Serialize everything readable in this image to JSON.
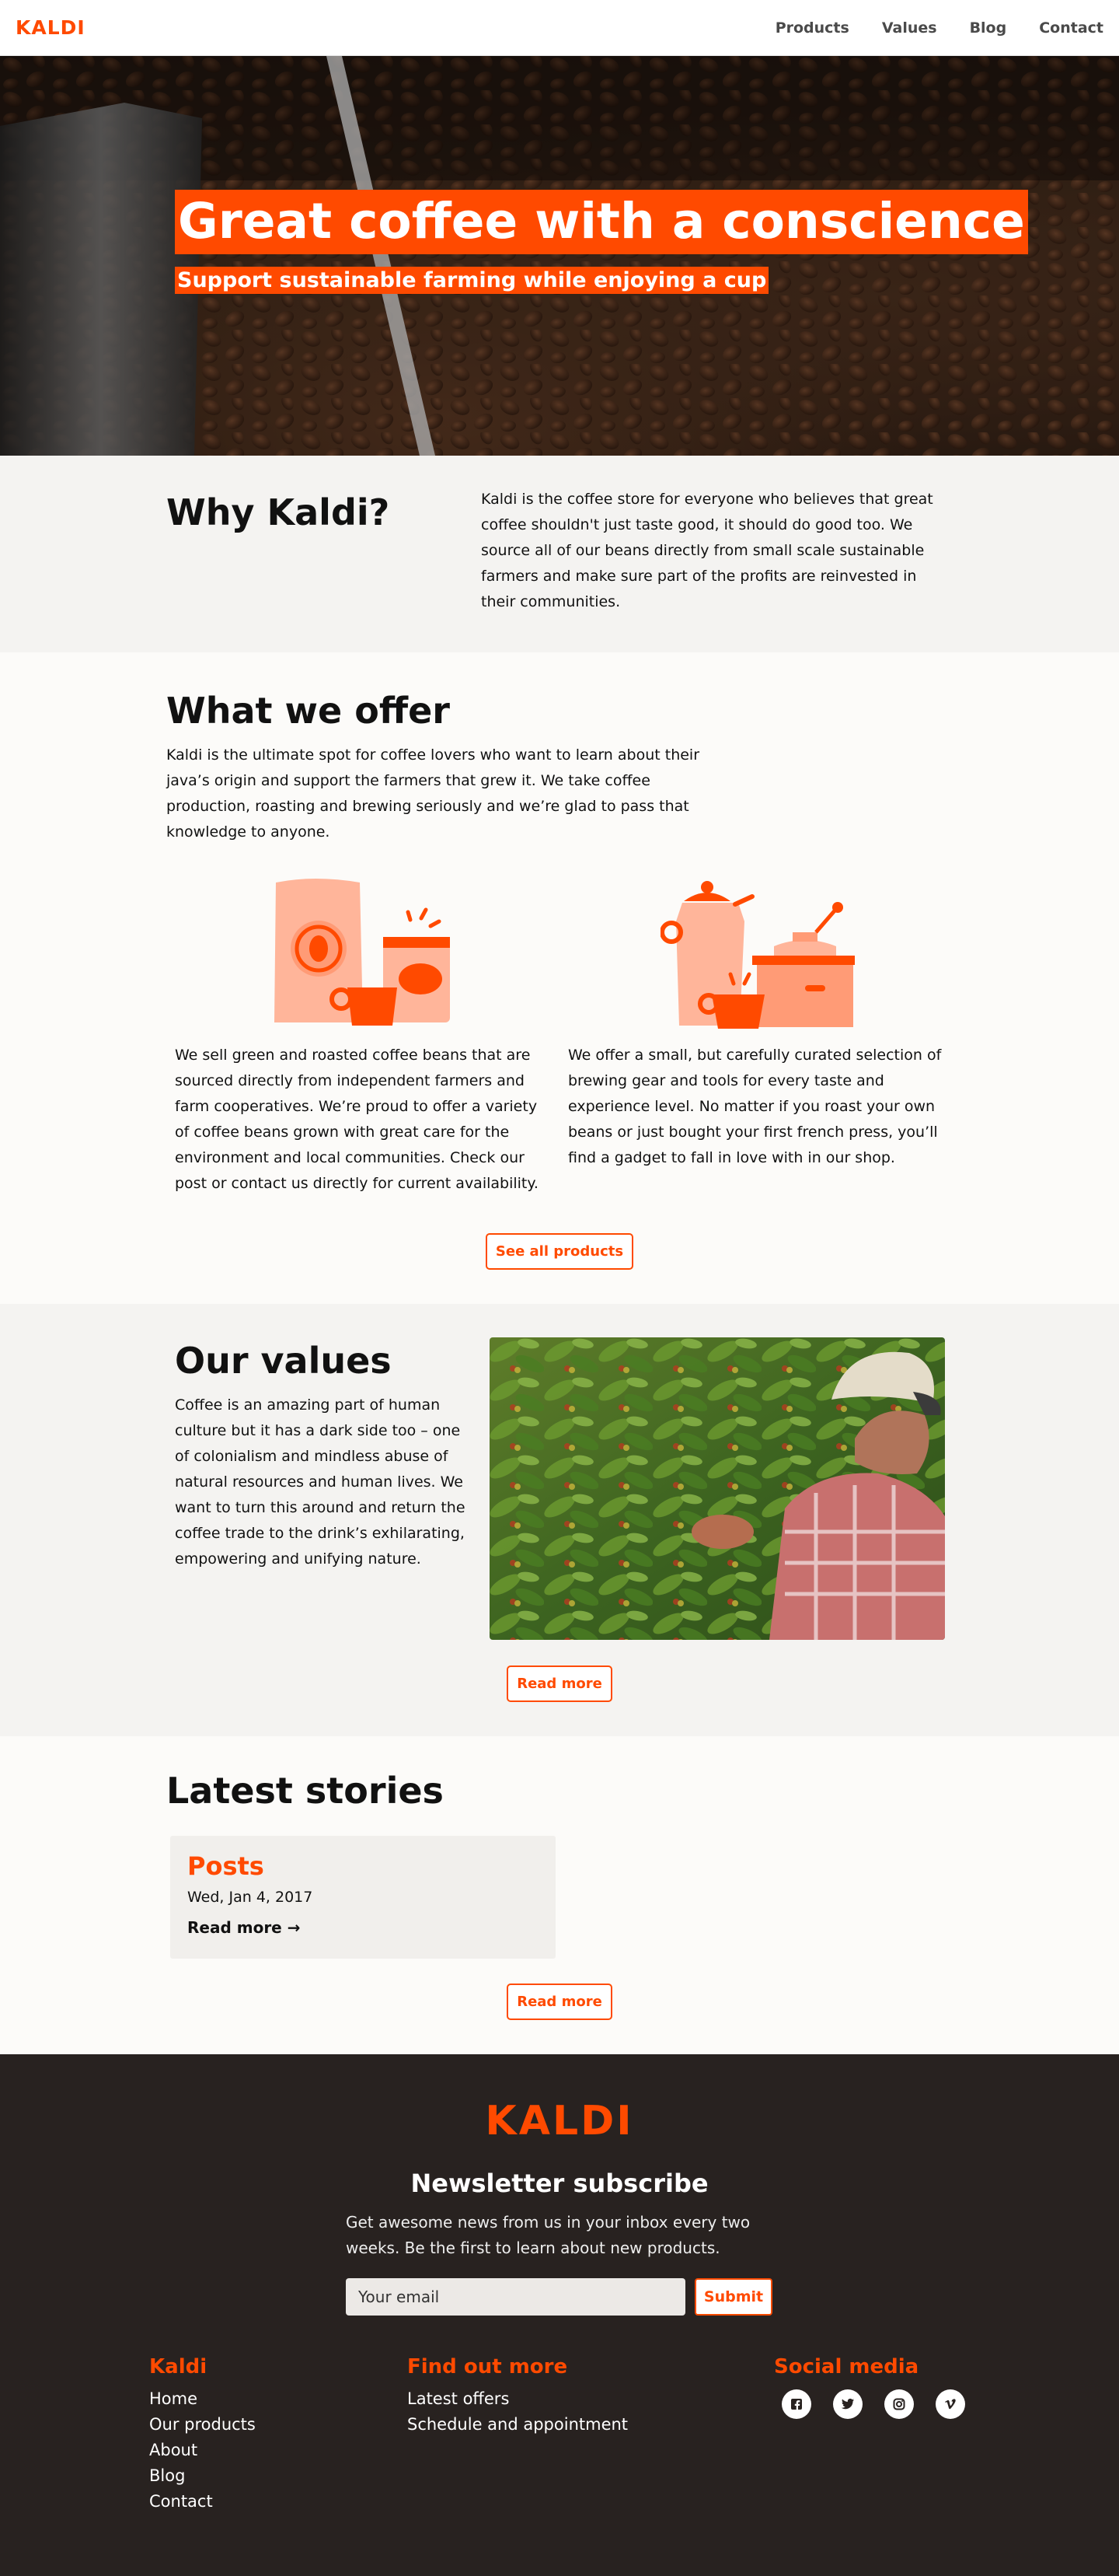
{
  "nav": {
    "logo": "KALDI",
    "links": [
      "Products",
      "Values",
      "Blog",
      "Contact"
    ]
  },
  "hero": {
    "title": "Great coffee with a conscience",
    "subtitle": "Support sustainable farming while enjoying a cup"
  },
  "why": {
    "heading": "Why Kaldi?",
    "text": "Kaldi is the coffee store for everyone who believes that great coffee shouldn't just taste good, it should do good too. We source all of our beans directly from small scale sustainable farmers and make sure part of the profits are reinvested in their communities."
  },
  "offer": {
    "heading": "What we offer",
    "intro": "Kaldi is the ultimate spot for coffee lovers who want to learn about their java’s origin and support the farmers that grew it. We take coffee production, roasting and brewing seriously and we’re glad to pass that knowledge to anyone.",
    "col1": "We sell green and roasted coffee beans that are sourced directly from independent farmers and farm cooperatives. We’re proud to offer a variety of coffee beans grown with great care for the environment and local communities. Check our post or contact us directly for current availability.",
    "col2": "We offer a small, but carefully curated selection of brewing gear and tools for every taste and experience level. No matter if you roast your own beans or just bought your first french press, you’ll find a gadget to fall in love with in our shop.",
    "button": "See all products"
  },
  "values": {
    "heading": "Our values",
    "text": "Coffee is an amazing part of human culture but it has a dark side too – one of colonialism and mindless abuse of natural resources and human lives. We want to turn this around and return the coffee trade to the drink’s exhilarating, empowering and unifying nature.",
    "button": "Read more"
  },
  "stories": {
    "heading": "Latest stories",
    "card": {
      "title": "Posts",
      "date": "Wed, Jan 4, 2017",
      "link": "Read more →"
    },
    "button": "Read more"
  },
  "footer": {
    "logo": "KALDI",
    "newsletter_heading": "Newsletter subscribe",
    "newsletter_text": "Get awesome news from us in your inbox every two weeks. Be the first to learn about new products.",
    "email_placeholder": "Your email",
    "submit": "Submit",
    "col1": {
      "heading": "Kaldi",
      "links": [
        "Home",
        "Our products",
        "About",
        "Blog",
        "Contact"
      ]
    },
    "col2": {
      "heading": "Find out more",
      "links": [
        "Latest offers",
        "Schedule and appointment"
      ]
    },
    "col3": {
      "heading": "Social media",
      "icons": [
        "facebook-icon",
        "twitter-icon",
        "instagram-icon",
        "vimeo-icon"
      ]
    }
  },
  "colors": {
    "accent": "#ff4a00",
    "footer_bg": "#282220",
    "section_gray": "#f4f3f1"
  }
}
